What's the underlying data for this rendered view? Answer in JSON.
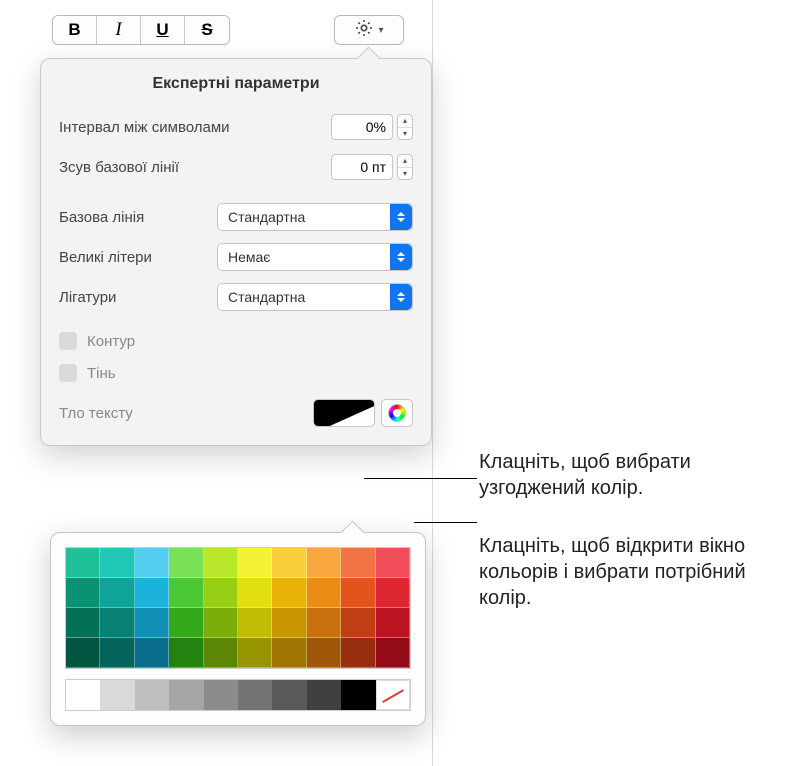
{
  "toolbar": {
    "bold": "B",
    "italic": "I",
    "underline": "U",
    "strike": "S"
  },
  "popover": {
    "title": "Експертні параметри",
    "char_spacing_label": "Інтервал між символами",
    "char_spacing_value": "0%",
    "baseline_shift_label": "Зсув базової лінії",
    "baseline_shift_value": "0 пт",
    "baseline_label": "Базова лінія",
    "baseline_value": "Стандартна",
    "caps_label": "Великі літери",
    "caps_value": "Немає",
    "ligatures_label": "Лігатури",
    "ligatures_value": "Стандартна",
    "outline_label": "Контур",
    "shadow_label": "Тінь",
    "text_bg_label": "Тло тексту"
  },
  "palette": {
    "rows": [
      [
        "#1fc199",
        "#21c8b8",
        "#55cff0",
        "#7ae058",
        "#b9e72c",
        "#f4f137",
        "#f9cf3c",
        "#f7a73e",
        "#f27446",
        "#ef4e58"
      ],
      [
        "#0a9373",
        "#0fa39a",
        "#1bb3db",
        "#4ac934",
        "#97cf17",
        "#e2df0e",
        "#eab30a",
        "#ea8c15",
        "#e3541c",
        "#de2730"
      ],
      [
        "#047055",
        "#078176",
        "#0f8fb5",
        "#32a91b",
        "#79ad09",
        "#c0be04",
        "#c99502",
        "#c9720d",
        "#c03e13",
        "#bb131f"
      ],
      [
        "#025641",
        "#04635b",
        "#0a6f8d",
        "#238310",
        "#5c8704",
        "#979601",
        "#9f7501",
        "#9e5708",
        "#972e0d",
        "#930b16"
      ]
    ],
    "bottom": [
      "#ffffff",
      "#d9d9d9",
      "#bfbfbf",
      "#a6a6a6",
      "#8c8c8c",
      "#737373",
      "#595959",
      "#3f3f3f",
      "#000000",
      "none"
    ]
  },
  "callouts": {
    "swatch": "Клацніть, щоб вибрати узгоджений колір.",
    "picker": "Клацніть, щоб відкрити вікно кольорів і вибрати потрібний колір."
  }
}
